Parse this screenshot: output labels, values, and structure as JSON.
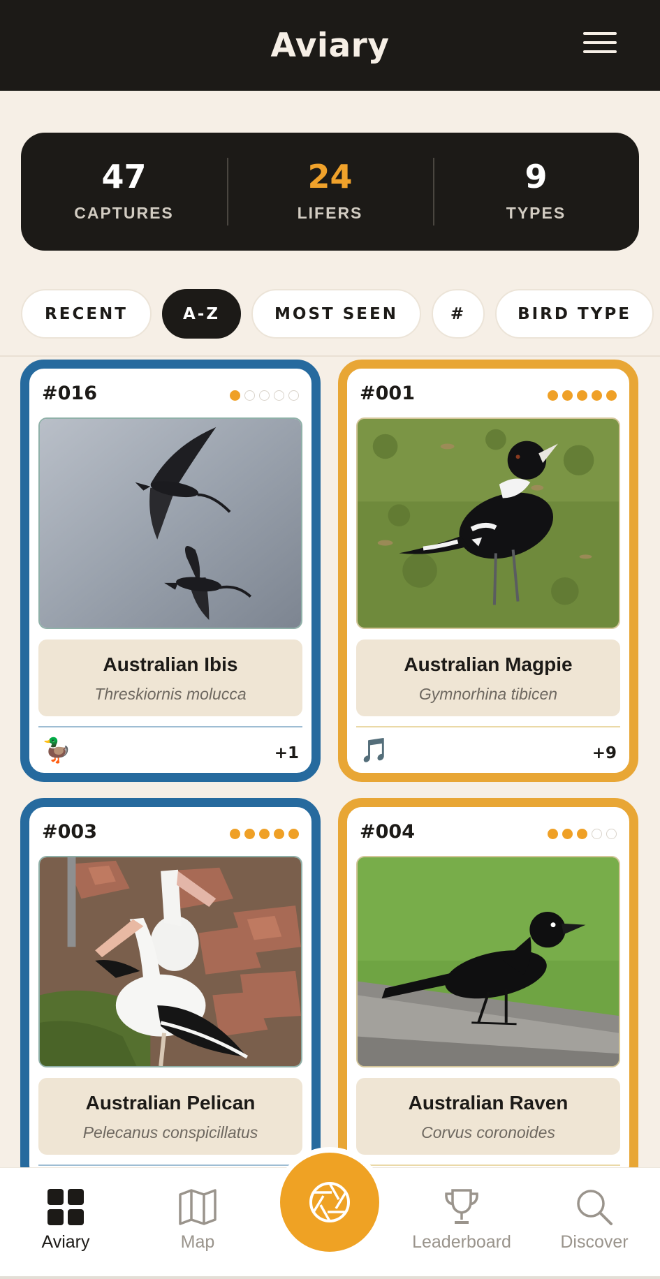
{
  "header": {
    "title": "Aviary",
    "menu_icon": "hamburger-menu-icon"
  },
  "stats": [
    {
      "value": "47",
      "label": "CAPTURES",
      "color": "#ffffff"
    },
    {
      "value": "24",
      "label": "LIFERS",
      "color": "#f0a22b"
    },
    {
      "value": "9",
      "label": "TYPES",
      "color": "#ffffff"
    }
  ],
  "filters": [
    {
      "label": "RECENT",
      "active": false
    },
    {
      "label": "A-Z",
      "active": true
    },
    {
      "label": "MOST SEEN",
      "active": false
    },
    {
      "label": "#",
      "active": false
    },
    {
      "label": "BIRD TYPE",
      "active": false
    }
  ],
  "cards": [
    {
      "number": "#016",
      "rating": 1,
      "rating_max": 5,
      "common_name": "Australian Ibis",
      "scientific_name": "Threskiornis molucca",
      "type_icon": "duck-icon",
      "type_glyph": "🦆",
      "count": "+1",
      "border": "blue"
    },
    {
      "number": "#001",
      "rating": 5,
      "rating_max": 5,
      "common_name": "Australian Magpie",
      "scientific_name": "Gymnorhina tibicen",
      "type_icon": "music-note-icon",
      "type_glyph": "🎵",
      "count": "+9",
      "border": "gold"
    },
    {
      "number": "#003",
      "rating": 5,
      "rating_max": 5,
      "common_name": "Australian Pelican",
      "scientific_name": "Pelecanus conspicillatus",
      "border": "blue"
    },
    {
      "number": "#004",
      "rating": 3,
      "rating_max": 5,
      "common_name": "Australian Raven",
      "scientific_name": "Corvus coronoides",
      "border": "gold"
    }
  ],
  "nav": {
    "items": [
      {
        "label": "Aviary",
        "icon": "grid-icon",
        "active": true
      },
      {
        "label": "Map",
        "icon": "map-icon",
        "active": false
      },
      {
        "label": "Leaderboard",
        "icon": "trophy-icon",
        "active": false
      },
      {
        "label": "Discover",
        "icon": "search-icon",
        "active": false
      }
    ],
    "center_icon": "camera-aperture-icon"
  },
  "colors": {
    "accent": "#efa224",
    "dark": "#1c1a17",
    "blue_border": "#266a9e",
    "gold_border": "#e8a635",
    "background": "#f6efe6"
  }
}
